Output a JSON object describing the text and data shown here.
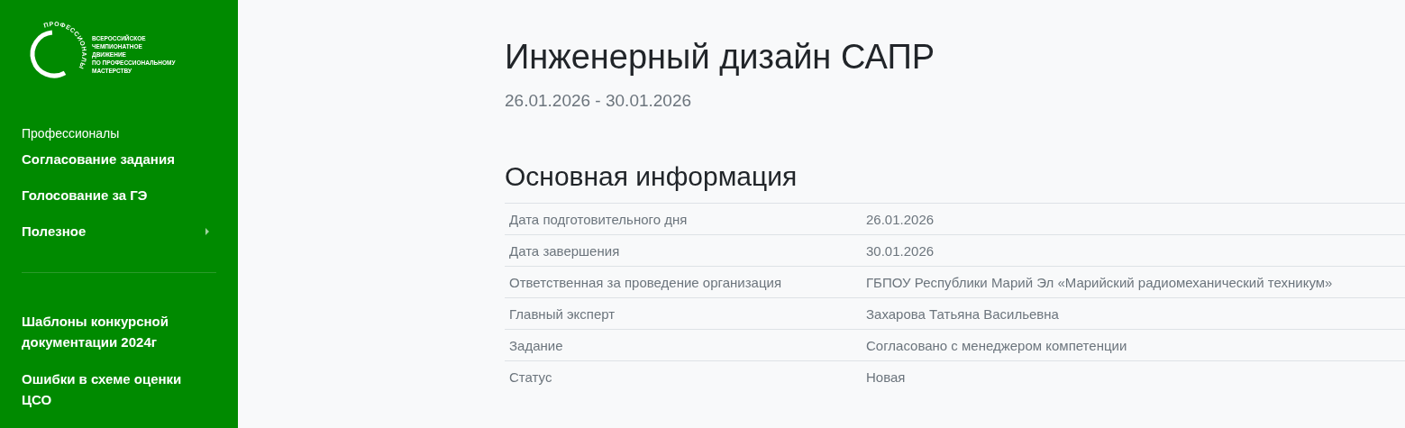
{
  "logo": {
    "arc_text": "ПРОФЕССИОНАЛЫ",
    "caption": [
      "ВСЕРОССИЙСКОЕ",
      "ЧЕМПИОНАТНОЕ",
      "ДВИЖЕНИЕ",
      "ПО ПРОФЕССИОНАЛЬНОМУ",
      "МАСТЕРСТВУ"
    ]
  },
  "sidebar": {
    "section": "Профессионалы",
    "items": [
      {
        "label": "Согласование задания",
        "expandable": false
      },
      {
        "label": "Голосование за ГЭ",
        "expandable": false
      },
      {
        "label": "Полезное",
        "expandable": true
      }
    ],
    "extra_items": [
      {
        "label": "Шаблоны конкурсной документации 2024г"
      },
      {
        "label": "Ошибки в схеме оценки ЦСО"
      }
    ]
  },
  "title": "Инженерный дизайн САПР",
  "dates": "26.01.2026 - 30.01.2026",
  "section_title": "Основная информация",
  "table": {
    "rows": [
      [
        "Дата подготовительного дня",
        "26.01.2026"
      ],
      [
        "Дата завершения",
        "30.01.2026"
      ],
      [
        "Ответственная за проведение организация",
        "ГБПОУ Республики Марий Эл «Марийский радиомеханический техникум»"
      ],
      [
        "Главный эксперт",
        "Захарова Татьяна Васильевна"
      ],
      [
        "Задание",
        "Согласовано с менеджером компетенции"
      ],
      [
        "Статус",
        "Новая"
      ]
    ]
  }
}
